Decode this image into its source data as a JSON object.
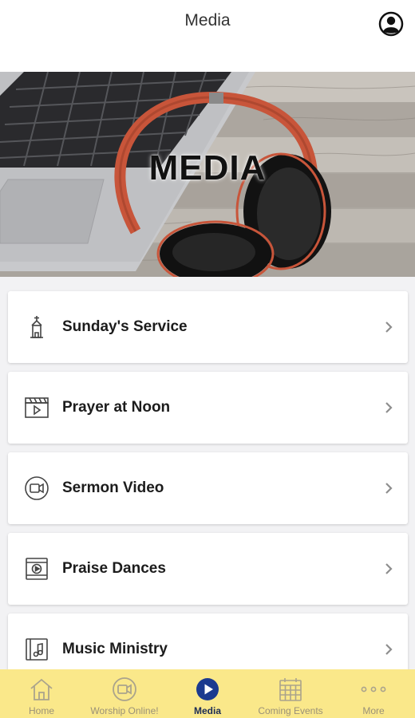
{
  "header": {
    "title": "Media",
    "profile_icon": "user-circle-icon"
  },
  "banner": {
    "text": "MEDIA"
  },
  "menu": {
    "items": [
      {
        "label": "Sunday's Service",
        "icon": "church-icon"
      },
      {
        "label": "Prayer at Noon",
        "icon": "video-clapper-icon"
      },
      {
        "label": "Sermon Video",
        "icon": "video-camera-icon"
      },
      {
        "label": "Praise Dances",
        "icon": "play-film-icon"
      },
      {
        "label": "Music Ministry",
        "icon": "music-note-icon"
      }
    ]
  },
  "tabbar": {
    "tabs": [
      {
        "label": "Home",
        "icon": "home-icon",
        "active": false
      },
      {
        "label": "Worship Online!",
        "icon": "video-camera-icon",
        "active": false
      },
      {
        "label": "Media",
        "icon": "play-circle-icon",
        "active": true
      },
      {
        "label": "Coming Events",
        "icon": "calendar-icon",
        "active": false
      },
      {
        "label": "More",
        "icon": "more-dots-icon",
        "active": false
      }
    ]
  },
  "colors": {
    "tabbar_bg": "#fae88a",
    "active_tab": "#1b3a8f",
    "inactive_tab": "#9a9178",
    "headphone_accent": "#c8553a"
  }
}
